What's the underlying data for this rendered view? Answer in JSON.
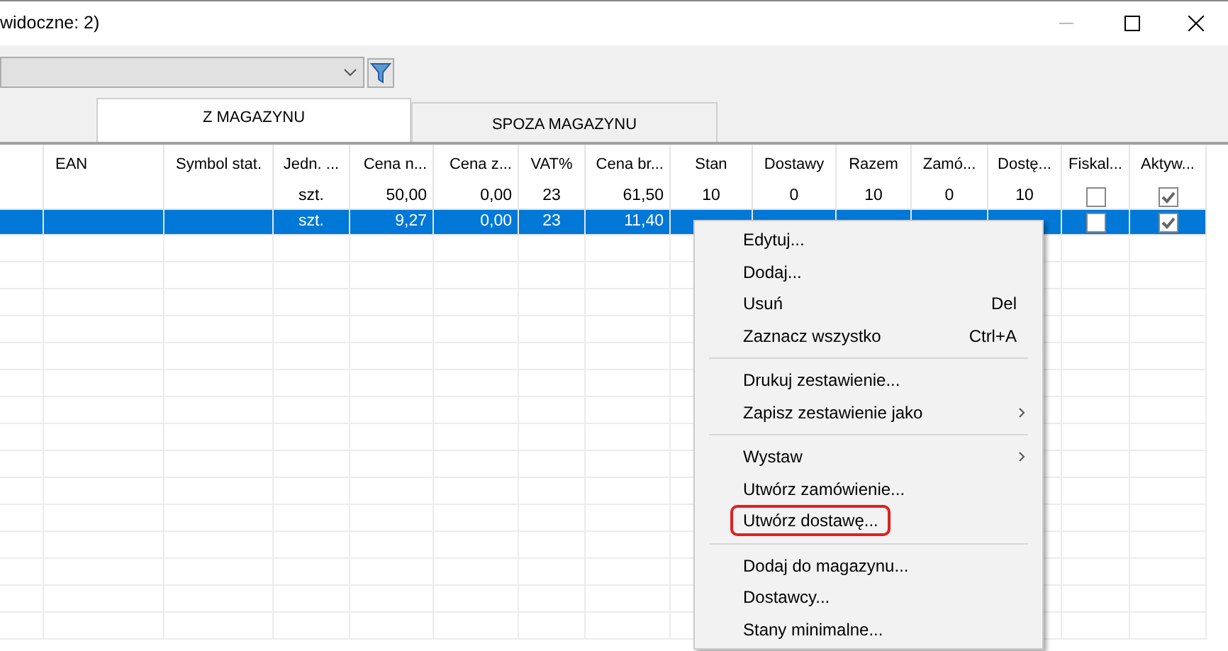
{
  "window": {
    "title": "widoczne: 2)"
  },
  "tabs": [
    {
      "label": "Z MAGAZYNU",
      "selected": true
    },
    {
      "label": "SPOZA MAGAZYNU",
      "selected": false
    }
  ],
  "table": {
    "columns": [
      null,
      "EAN",
      "Symbol stat.",
      "Jedn. ...",
      "Cena n...",
      "Cena z...",
      "VAT%",
      "Cena br...",
      "Stan",
      "Dostawy",
      "Razem",
      "Zamó...",
      "Dostę...",
      "Fiskal...",
      "Aktyw..."
    ],
    "rows": [
      {
        "selected": false,
        "cells": [
          null,
          null,
          null,
          "szt.",
          "50,00",
          "0,00",
          "23",
          "61,50",
          "10",
          "0",
          "10",
          "0",
          "10"
        ],
        "fiscal": false,
        "active": true
      },
      {
        "selected": true,
        "cells": [
          null,
          null,
          null,
          "szt.",
          "9,27",
          "0,00",
          "23",
          "11,40",
          null,
          null,
          null,
          null,
          null
        ],
        "fiscal": false,
        "active": true
      }
    ]
  },
  "context_menu": [
    {
      "kind": "item",
      "label": "Edytuj...",
      "submenu": false,
      "highlighted": false
    },
    {
      "kind": "item",
      "label": "Dodaj...",
      "submenu": false,
      "highlighted": false
    },
    {
      "kind": "item",
      "label": "Usuń",
      "shortcut": "Del",
      "submenu": false,
      "highlighted": false
    },
    {
      "kind": "item",
      "label": "Zaznacz wszystko",
      "shortcut": "Ctrl+A",
      "submenu": false,
      "highlighted": false
    },
    {
      "kind": "separator"
    },
    {
      "kind": "item",
      "label": "Drukuj zestawienie...",
      "submenu": false,
      "highlighted": false
    },
    {
      "kind": "item",
      "label": "Zapisz zestawienie jako",
      "submenu": true,
      "highlighted": false
    },
    {
      "kind": "separator"
    },
    {
      "kind": "item",
      "label": "Wystaw",
      "submenu": true,
      "highlighted": false
    },
    {
      "kind": "item",
      "label": "Utwórz zamówienie...",
      "submenu": false,
      "highlighted": false
    },
    {
      "kind": "item",
      "label": "Utwórz dostawę...",
      "submenu": false,
      "highlighted": true
    },
    {
      "kind": "separator"
    },
    {
      "kind": "item",
      "label": "Dodaj do magazynu...",
      "submenu": false,
      "highlighted": false
    },
    {
      "kind": "item",
      "label": "Dostawcy...",
      "submenu": false,
      "highlighted": false
    },
    {
      "kind": "item",
      "label": "Stany minimalne...",
      "submenu": false,
      "highlighted": false
    }
  ]
}
